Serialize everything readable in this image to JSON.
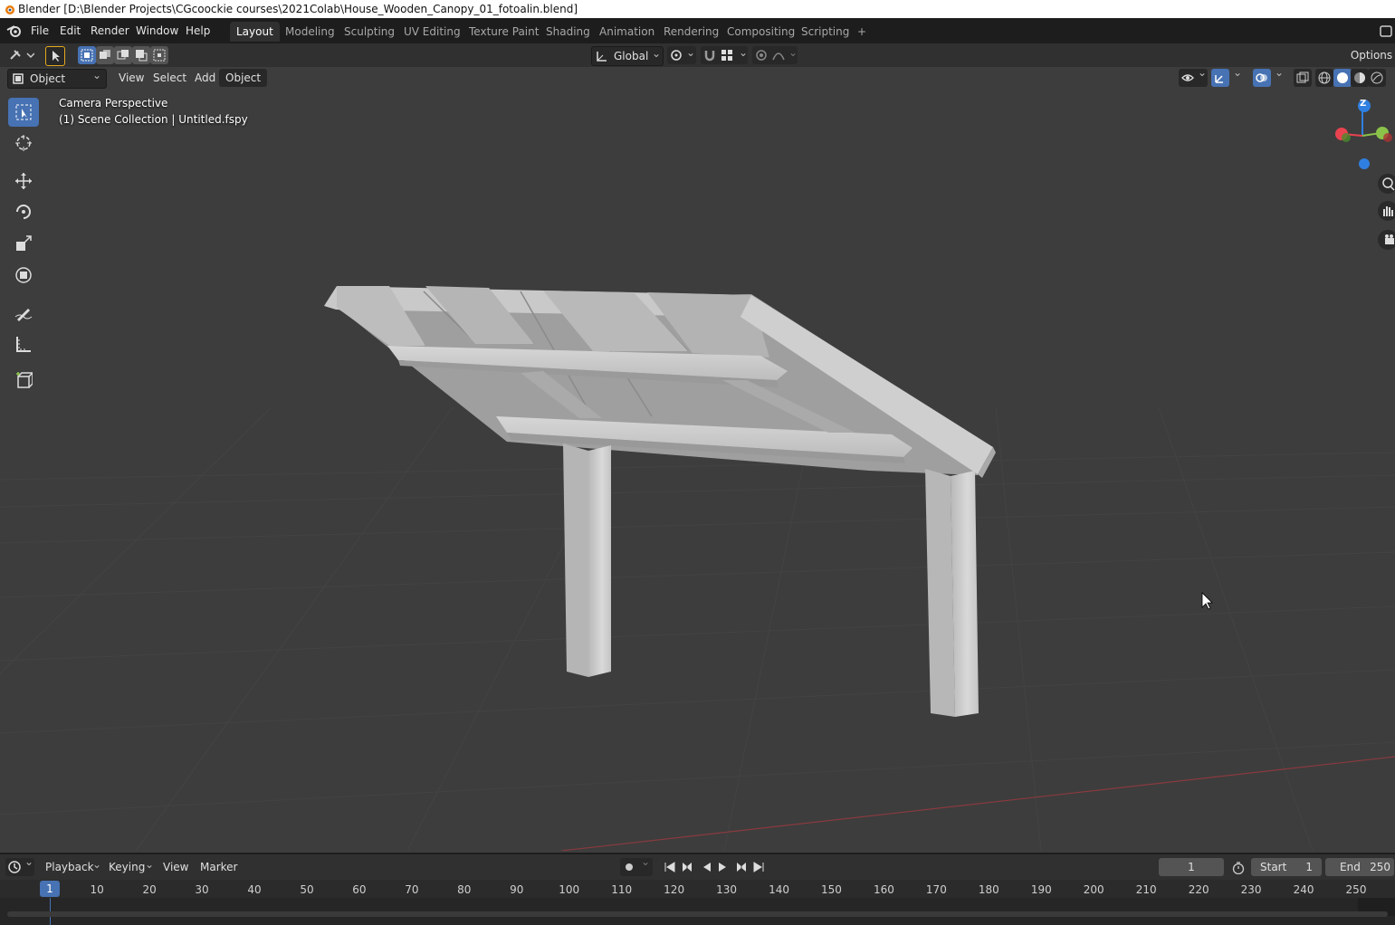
{
  "window": {
    "title": "Blender [D:\\Blender Projects\\CGcoockie courses\\2021Colab\\House_Wooden_Canopy_01_fotoalin.blend]"
  },
  "menu": {
    "items": [
      "File",
      "Edit",
      "Render",
      "Window",
      "Help"
    ]
  },
  "workspaces": {
    "tabs": [
      "Layout",
      "Modeling",
      "Sculpting",
      "UV Editing",
      "Texture Paint",
      "Shading",
      "Animation",
      "Rendering",
      "Compositing",
      "Scripting"
    ],
    "active": "Layout",
    "add_label": "+"
  },
  "tool_header": {
    "transform_orientation": "Global",
    "options_label": "Options"
  },
  "viewport_header": {
    "mode": "Object Mode",
    "menus": [
      "View",
      "Select",
      "Add",
      "Object"
    ]
  },
  "viewport": {
    "perspective_label": "Camera Perspective",
    "collection_label": "(1) Scene Collection | Untitled.fspy",
    "gizmo": {
      "z_label": "Z"
    }
  },
  "timeline": {
    "menus": [
      "Playback",
      "Keying",
      "View",
      "Marker"
    ],
    "current_frame": "1",
    "start_label": "Start",
    "start_value": "1",
    "end_label": "End",
    "end_value": "250",
    "ticks": [
      "10",
      "20",
      "30",
      "40",
      "50",
      "60",
      "70",
      "80",
      "90",
      "100",
      "110",
      "120",
      "130",
      "140",
      "150",
      "160",
      "170",
      "180",
      "190",
      "200",
      "210",
      "220",
      "230",
      "240",
      "250"
    ],
    "playhead_label": "1"
  },
  "colors": {
    "accent": "#4772b3",
    "x_axis": "#e8434f",
    "y_axis": "#8bc34a",
    "z_axis": "#2f7fe0"
  }
}
